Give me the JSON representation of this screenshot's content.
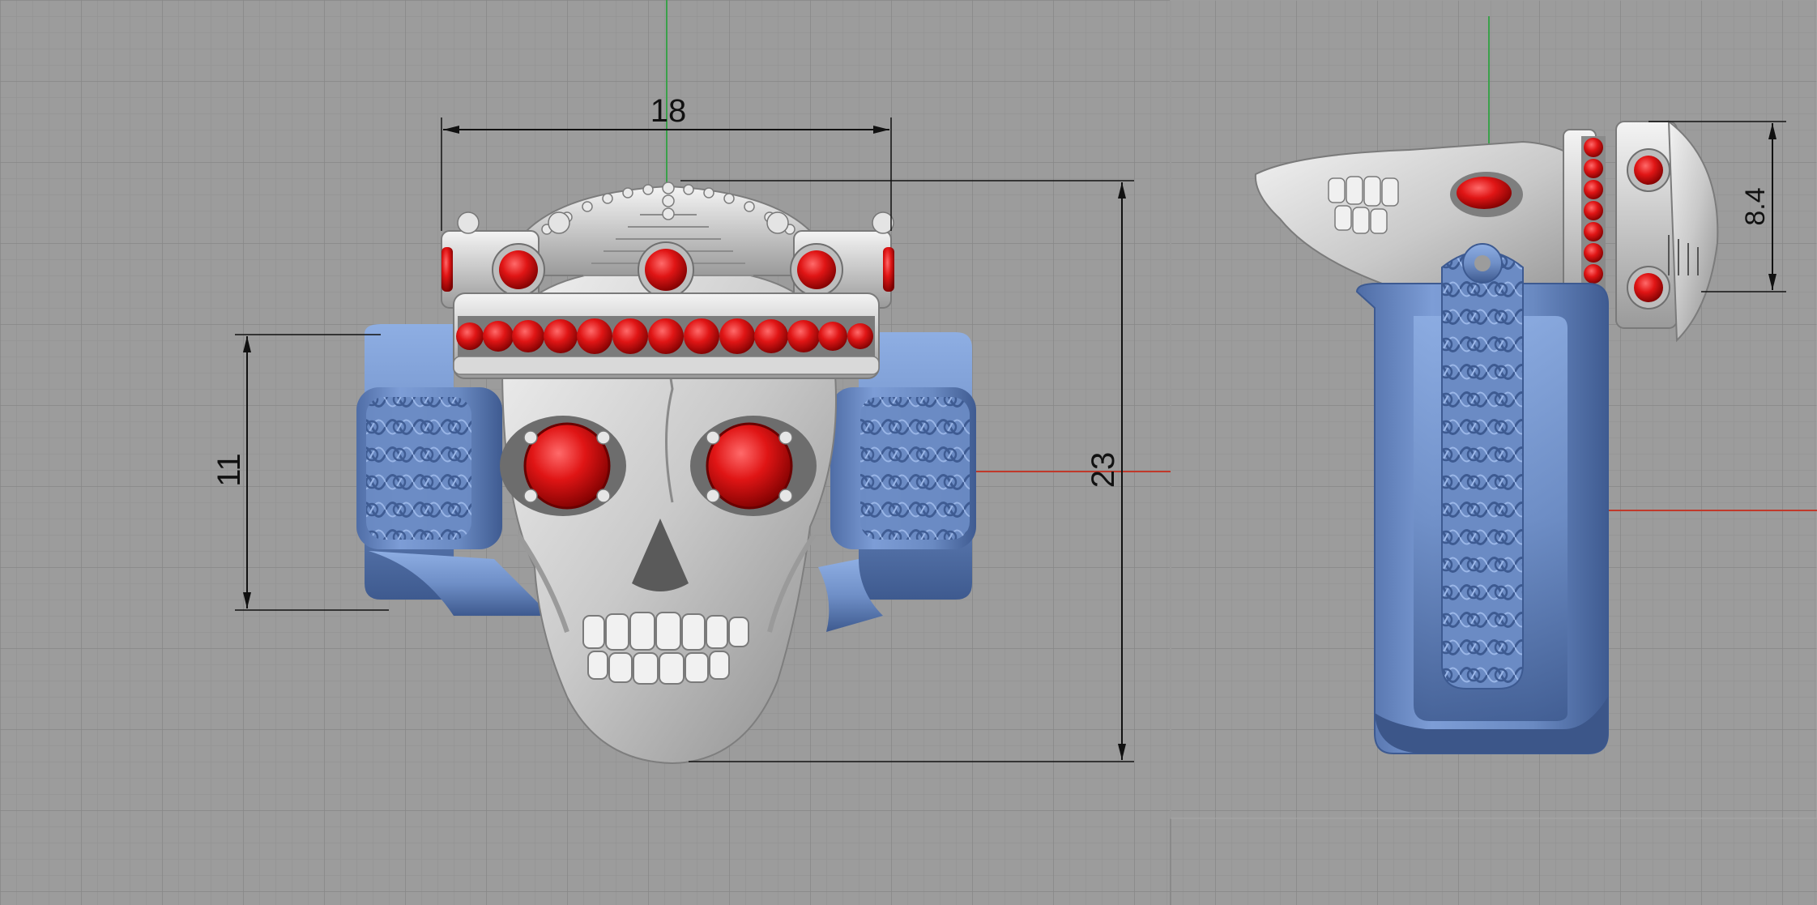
{
  "viewports": [
    {
      "name": "front-view",
      "dimensions": {
        "width_label": "18",
        "total_height_label": "23",
        "band_height_label": "11"
      }
    },
    {
      "name": "side-view",
      "dimensions": {
        "crown_height_label": "8.4"
      }
    }
  ],
  "colors": {
    "background": "#9c9c9c",
    "grid_minor": "#909090",
    "grid_major": "#868686",
    "band_blue": "#6f8fc7",
    "band_blue_dark": "#4c6aa3",
    "metal_silver": "#cfcfcf",
    "metal_shadow": "#8a8a8a",
    "gem_red": "#d81818",
    "gem_red_dark": "#8f0000",
    "axis_x": "#c0392b",
    "axis_y": "#3aa04a",
    "dimension_line": "#111111"
  }
}
